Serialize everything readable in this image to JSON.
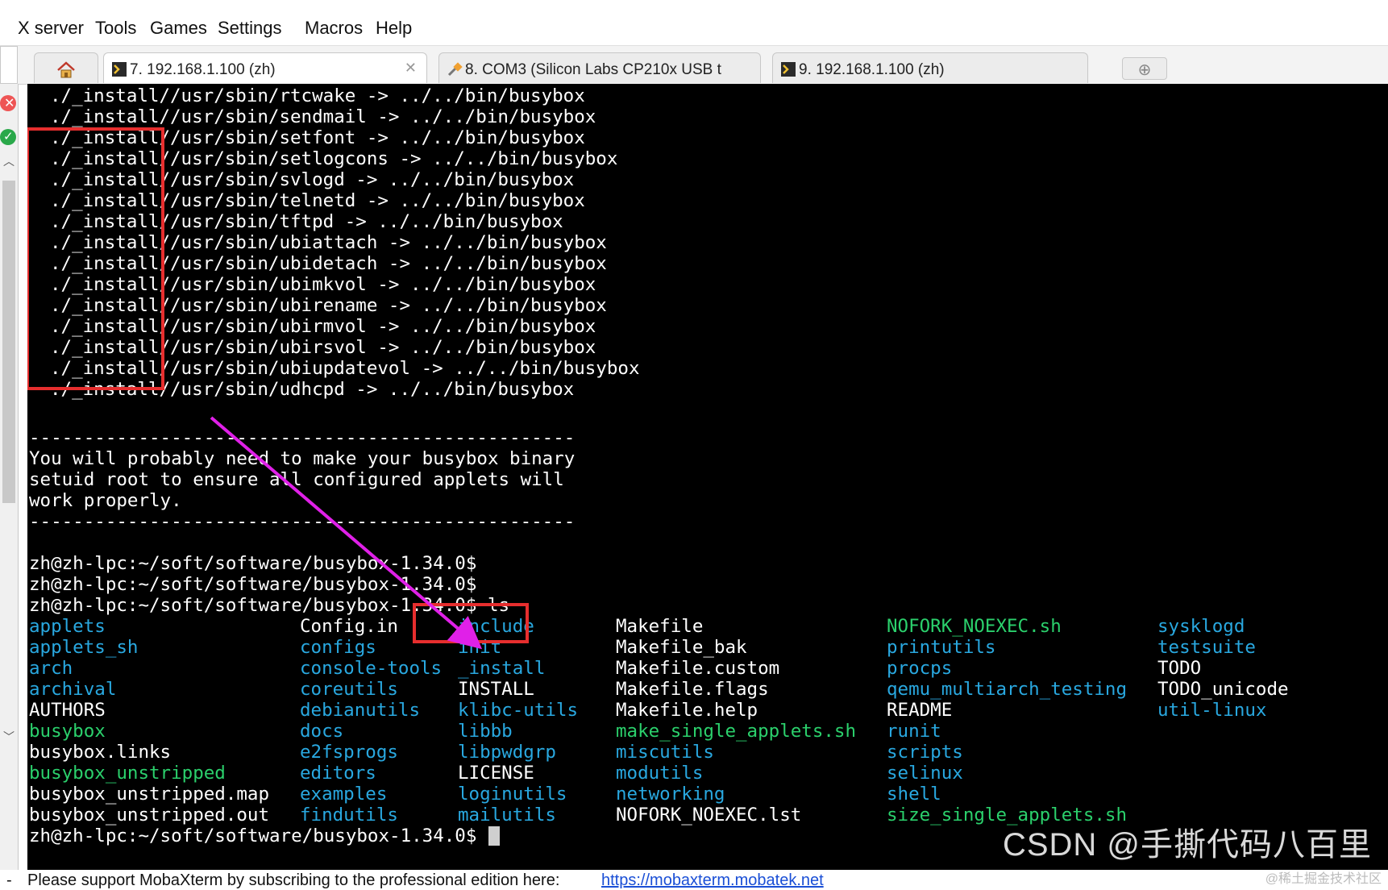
{
  "menu": [
    "X server",
    "Tools",
    "Games",
    "Settings",
    "Macros",
    "Help"
  ],
  "tabs": [
    {
      "label": "7. 192.168.1.100 (zh)",
      "icon": "terminal-icon"
    },
    {
      "label": "8. COM3  (Silicon Labs CP210x USB t",
      "icon": "serial-plug-icon"
    },
    {
      "label": "9. 192.168.1.100 (zh)",
      "icon": "terminal-icon"
    }
  ],
  "terminal": {
    "install_lines": [
      "./_install//usr/sbin/rtcwake -> ../../bin/busybox",
      "./_install//usr/sbin/sendmail -> ../../bin/busybox",
      "./_install//usr/sbin/setfont -> ../../bin/busybox",
      "./_install//usr/sbin/setlogcons -> ../../bin/busybox",
      "./_install//usr/sbin/svlogd -> ../../bin/busybox",
      "./_install//usr/sbin/telnetd -> ../../bin/busybox",
      "./_install//usr/sbin/tftpd -> ../../bin/busybox",
      "./_install//usr/sbin/ubiattach -> ../../bin/busybox",
      "./_install//usr/sbin/ubidetach -> ../../bin/busybox",
      "./_install//usr/sbin/ubimkvol -> ../../bin/busybox",
      "./_install//usr/sbin/ubirename -> ../../bin/busybox",
      "./_install//usr/sbin/ubirmvol -> ../../bin/busybox",
      "./_install//usr/sbin/ubirsvol -> ../../bin/busybox",
      "./_install//usr/sbin/ubiupdatevol -> ../../bin/busybox",
      "./_install//usr/sbin/udhcpd -> ../../bin/busybox"
    ],
    "separator": "--------------------------------------------------",
    "message_lines": [
      "You will probably need to make your busybox binary",
      "setuid root to ensure all configured applets will",
      "work properly."
    ],
    "prompt_lines": [
      "zh@zh-lpc:~/soft/software/busybox-1.34.0$",
      "zh@zh-lpc:~/soft/software/busybox-1.34.0$",
      "zh@zh-lpc:~/soft/software/busybox-1.34.0$ ls"
    ],
    "ls_columns": [
      [
        {
          "t": "applets",
          "c": "blue"
        },
        {
          "t": "applets_sh",
          "c": "blue"
        },
        {
          "t": "arch",
          "c": "blue"
        },
        {
          "t": "archival",
          "c": "blue"
        },
        {
          "t": "AUTHORS",
          "c": "white"
        },
        {
          "t": "busybox",
          "c": "green"
        },
        {
          "t": "busybox.links",
          "c": "white"
        },
        {
          "t": "busybox_unstripped",
          "c": "green"
        },
        {
          "t": "busybox_unstripped.map",
          "c": "white"
        },
        {
          "t": "busybox_unstripped.out",
          "c": "white"
        }
      ],
      [
        {
          "t": "Config.in",
          "c": "white"
        },
        {
          "t": "configs",
          "c": "blue"
        },
        {
          "t": "console-tools",
          "c": "blue"
        },
        {
          "t": "coreutils",
          "c": "blue"
        },
        {
          "t": "debianutils",
          "c": "blue"
        },
        {
          "t": "docs",
          "c": "blue"
        },
        {
          "t": "e2fsprogs",
          "c": "blue"
        },
        {
          "t": "editors",
          "c": "blue"
        },
        {
          "t": "examples",
          "c": "blue"
        },
        {
          "t": "findutils",
          "c": "blue"
        }
      ],
      [
        {
          "t": "include",
          "c": "blue"
        },
        {
          "t": "init",
          "c": "blue"
        },
        {
          "t": "_install",
          "c": "blue"
        },
        {
          "t": "INSTALL",
          "c": "white"
        },
        {
          "t": "klibc-utils",
          "c": "blue"
        },
        {
          "t": "libbb",
          "c": "blue"
        },
        {
          "t": "libpwdgrp",
          "c": "blue"
        },
        {
          "t": "LICENSE",
          "c": "white"
        },
        {
          "t": "loginutils",
          "c": "blue"
        },
        {
          "t": "mailutils",
          "c": "blue"
        }
      ],
      [
        {
          "t": "Makefile",
          "c": "white"
        },
        {
          "t": "Makefile_bak",
          "c": "white"
        },
        {
          "t": "Makefile.custom",
          "c": "white"
        },
        {
          "t": "Makefile.flags",
          "c": "white"
        },
        {
          "t": "Makefile.help",
          "c": "white"
        },
        {
          "t": "make_single_applets.sh",
          "c": "green"
        },
        {
          "t": "miscutils",
          "c": "blue"
        },
        {
          "t": "modutils",
          "c": "blue"
        },
        {
          "t": "networking",
          "c": "blue"
        },
        {
          "t": "NOFORK_NOEXEC.lst",
          "c": "white"
        }
      ],
      [
        {
          "t": "NOFORK_NOEXEC.sh",
          "c": "green"
        },
        {
          "t": "printutils",
          "c": "blue"
        },
        {
          "t": "procps",
          "c": "blue"
        },
        {
          "t": "qemu_multiarch_testing",
          "c": "blue"
        },
        {
          "t": "README",
          "c": "white"
        },
        {
          "t": "runit",
          "c": "blue"
        },
        {
          "t": "scripts",
          "c": "blue"
        },
        {
          "t": "selinux",
          "c": "blue"
        },
        {
          "t": "shell",
          "c": "blue"
        },
        {
          "t": "size_single_applets.sh",
          "c": "green"
        }
      ],
      [
        {
          "t": "sysklogd",
          "c": "blue"
        },
        {
          "t": "testsuite",
          "c": "blue"
        },
        {
          "t": "TODO",
          "c": "white"
        },
        {
          "t": "TODO_unicode",
          "c": "white"
        },
        {
          "t": "util-linux",
          "c": "blue"
        }
      ]
    ],
    "final_prompt": "zh@zh-lpc:~/soft/software/busybox-1.34.0$"
  },
  "colors": {
    "blue": "#29a8e0",
    "green": "#2bd06c",
    "white": "#ffffff",
    "annotation_red": "#e62e2e",
    "annotation_arrow": "#e020e8"
  },
  "status": {
    "text": "Please support MobaXterm by subscribing to the professional edition here:",
    "link": "https://mobaxterm.mobatek.net"
  },
  "watermark": {
    "main": "CSDN @手撕代码八百里",
    "small": "@稀土掘金技术社区"
  }
}
